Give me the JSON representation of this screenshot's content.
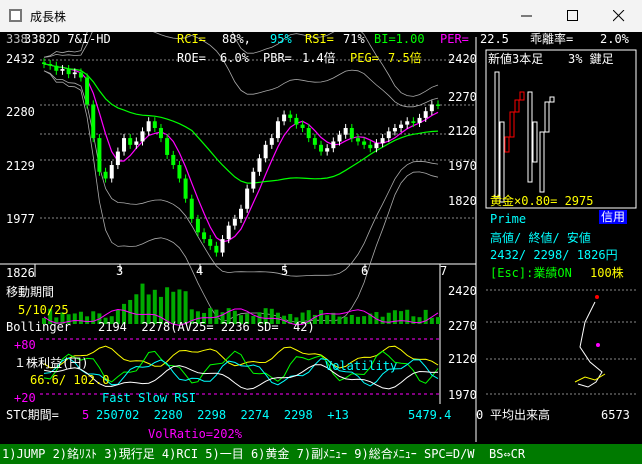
{
  "window": {
    "title": "成長株"
  },
  "header": {
    "code_name": "3382D 7&I-HD",
    "code_prefix": "338",
    "rci_label": "RCI=",
    "rci_value": "88%,",
    "rci_value2": "95%",
    "rsi_label": "RSI=",
    "rsi_value": "71%",
    "bi_label": "BI=1.00",
    "per_label": "PER=",
    "per_value": "22.5",
    "deviation_label": "乖離率=",
    "deviation_value": "2.0%",
    "roe_label": "ROE=",
    "roe_value": "6.0%",
    "pbr_label": "PBR=",
    "pbr_value": "1.4倍",
    "peg_label": "PEG=",
    "peg_value": "7.5倍"
  },
  "price_axis": [
    "2432",
    "2280",
    "2129",
    "1977",
    "1826"
  ],
  "month_labels": [
    "3",
    "4",
    "5",
    "6",
    "7"
  ],
  "right_panel": {
    "pnf_title": "新値3本足",
    "kagi_title": "3% 鍵足",
    "axis": [
      "2420",
      "2270",
      "2120",
      "1970",
      "1820"
    ],
    "gold": "黄金×0.80= 2975",
    "market": "Prime",
    "broker": "信用",
    "hlc_label": "高値/ 終値/ 安値",
    "hlc_values": "2432/ 2298/ 1826円",
    "esc": "[Esc]:業績ON",
    "lot": "100株",
    "axis2": [
      "2420",
      "2270",
      "2120",
      "1970"
    ],
    "avg_volume_label": "平均出来高",
    "avg_volume_value": "6573",
    "zero": "0"
  },
  "indicators": {
    "ma_label": "移動期間",
    "ma_periods": "5/10/25",
    "bb_label": "Bollinger",
    "bb_values": "2194  2278(AV25= 2236 SD=  42)",
    "plus80": "+80",
    "eps_label": "１株利益(円)",
    "eps_values": "66.6/ 102.0",
    "volatility": "Volatility",
    "plus20": "+20",
    "fast_slow": "Fast Slow RSI",
    "stc_label": "STC期間=",
    "stc_period": "5",
    "stc_values": "250702  2280  2298  2274  2298  +13",
    "stc_last": "5479.4",
    "vol_ratio": "VolRatio=202%"
  },
  "bottom_menu": "1)JUMP 2)銘ﾘｽﾄ 3)現行足 4)RCI 5)一目 6)黄金 7)副ﾒﾆｭｰ 9)総合ﾒﾆｭｰ SPC=D/W  BS⇔CR",
  "chart_data": {
    "type": "candlestick",
    "title": "3382D 7&I-HD",
    "x_months": [
      "3",
      "4",
      "5",
      "6",
      "7"
    ],
    "ylim": [
      1826,
      2432
    ],
    "y_ticks": [
      2432,
      2280,
      2129,
      1977,
      1826
    ],
    "close": [
      2420,
      2415,
      2400,
      2405,
      2390,
      2395,
      2380,
      2300,
      2200,
      2100,
      2080,
      2120,
      2160,
      2200,
      2180,
      2190,
      2220,
      2250,
      2230,
      2200,
      2150,
      2120,
      2080,
      2020,
      1960,
      1920,
      1900,
      1880,
      1860,
      1900,
      1940,
      1960,
      1990,
      2050,
      2100,
      2140,
      2180,
      2200,
      2250,
      2270,
      2260,
      2240,
      2230,
      2200,
      2180,
      2160,
      2170,
      2190,
      2210,
      2230,
      2200,
      2190,
      2180,
      2170,
      2185,
      2200,
      2220,
      2230,
      2240,
      2250,
      2245,
      2260,
      2280,
      2300,
      2298
    ],
    "colors": {
      "up": "#ffffff",
      "down": "#00ff00",
      "ma5": "#ff00ff",
      "ma25": "#00ff00",
      "bb": "#aaaaaa"
    }
  }
}
